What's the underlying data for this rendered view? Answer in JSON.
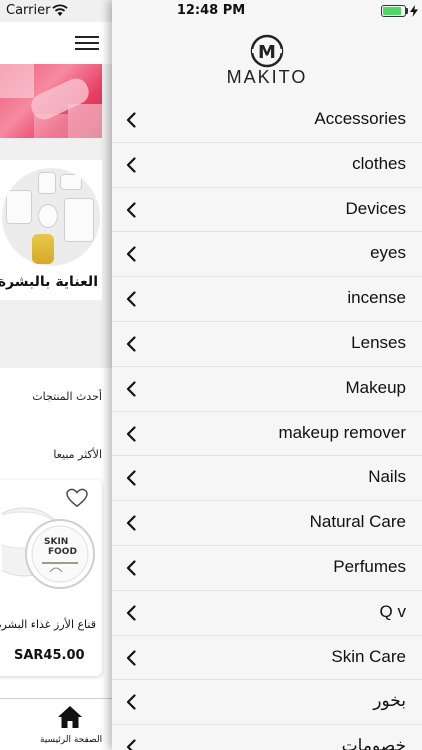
{
  "status_bar": {
    "carrier": "Carrier",
    "time": "12:48 PM",
    "battery_level": 0.85,
    "battery_color": "#4cd964",
    "wifi_icon": "wifi-icon",
    "charging_icon": "bolt-icon"
  },
  "home": {
    "menu_icon": "hamburger-icon",
    "category_title": "العناية بالبشرة",
    "latest_products_label": "أحدث المنتجات",
    "best_sellers_label": "الأكثر مبيعا",
    "product": {
      "name": "قناع الأرز غذاء البشرة",
      "price": "SAR45.00",
      "favorite_icon": "heart-icon"
    },
    "tab": {
      "label": "الصفحة الرئيسية",
      "icon": "home-icon"
    }
  },
  "drawer": {
    "brand": "MAKITO",
    "logo_letter": "M",
    "chevron_icon": "chevron-left-icon",
    "items": [
      {
        "label": "Accessories"
      },
      {
        "label": "clothes"
      },
      {
        "label": "Devices"
      },
      {
        "label": "eyes"
      },
      {
        "label": "incense"
      },
      {
        "label": "Lenses"
      },
      {
        "label": "Makeup"
      },
      {
        "label": "makeup remover"
      },
      {
        "label": "Nails"
      },
      {
        "label": "Natural Care"
      },
      {
        "label": "Perfumes"
      },
      {
        "label": "Q v"
      },
      {
        "label": "Skin Care"
      },
      {
        "label": "بخور"
      },
      {
        "label": "خصومات"
      }
    ]
  }
}
